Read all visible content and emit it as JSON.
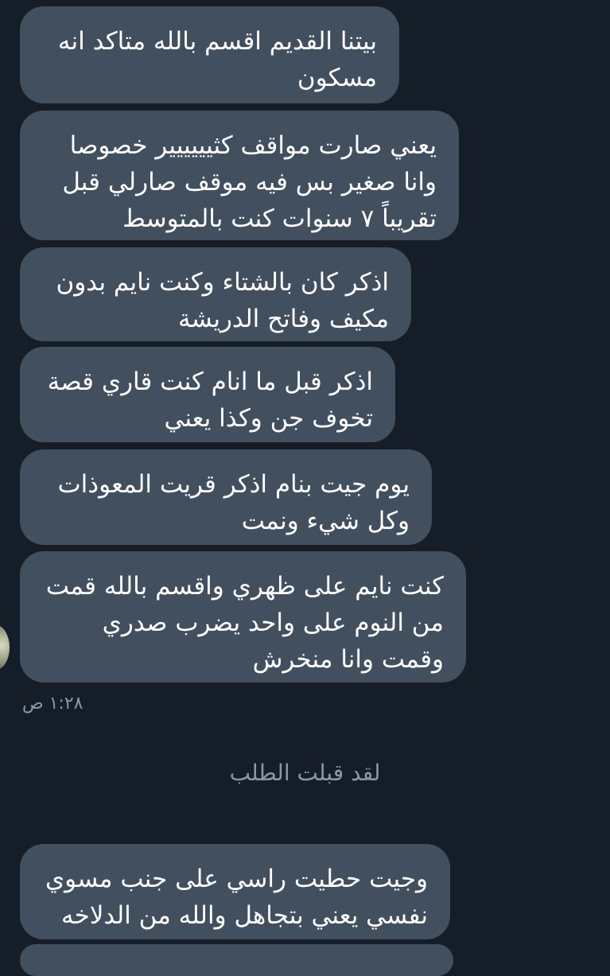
{
  "messages": [
    {
      "lines": [
        "بيتنا القديم اقسم بالله متاكد انه",
        "مسكون"
      ]
    },
    {
      "lines": [
        "يعني صارت مواقف كثيييييير خصوصا",
        "وانا صغير بس فيه موقف صارلي قبل",
        "تقريباً ٧ سنوات كنت بالمتوسط"
      ]
    },
    {
      "lines": [
        "اذكر كان بالشتاء وكنت نايم بدون",
        "مكيف وفاتح الدريشة"
      ]
    },
    {
      "lines": [
        "اذكر قبل ما انام كنت قاري قصة",
        "تخوف جن وكذا يعني"
      ]
    },
    {
      "lines": [
        "يوم جيت بنام اذكر قريت المعوذات",
        "وكل شيء ونمت"
      ]
    },
    {
      "lines": [
        "كنت نايم على ظهري واقسم بالله قمت",
        "من النوم على واحد يضرب صدري",
        "وقمت وانا منخرش"
      ]
    },
    {
      "lines": [
        "وجيت حطيت راسي على جنب مسوي",
        "نفسي يعني بتجاهل والله من الدلاخه"
      ]
    }
  ],
  "timestamp": "١:٢٨ ص",
  "system_message": "لقد قبلت الطلب",
  "colors": {
    "background": "#151d28",
    "bubble": "#414f5f",
    "text": "#ffffff",
    "muted": "#8b98a5"
  }
}
